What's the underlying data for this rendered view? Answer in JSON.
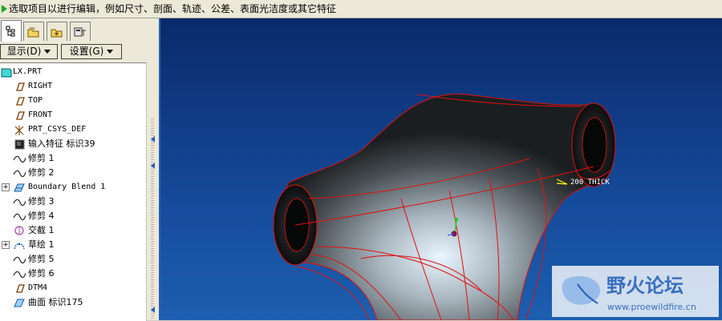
{
  "status": {
    "message": "选取项目以进行编辑，例如尺寸、剖面、轨迹、公差、表面光洁度或其它特征"
  },
  "tabs": [
    {
      "name": "model-tree"
    },
    {
      "name": "folder-browser"
    },
    {
      "name": "favorites"
    },
    {
      "name": "connections"
    }
  ],
  "toolbar": {
    "show_label": "显示(D)",
    "settings_label": "设置(G)"
  },
  "tree": {
    "items": [
      {
        "label": "LX.PRT",
        "icon": "part-icon"
      },
      {
        "label": "RIGHT",
        "icon": "datum-plane-icon"
      },
      {
        "label": "TOP",
        "icon": "datum-plane-icon"
      },
      {
        "label": "FRONT",
        "icon": "datum-plane-icon"
      },
      {
        "label": "PRT_CSYS_DEF",
        "icon": "coordinate-system-icon"
      },
      {
        "label": "输入特征 标识39",
        "icon": "import-feature-icon"
      },
      {
        "label": "修剪 1",
        "icon": "trim-curve-icon"
      },
      {
        "label": "修剪 2",
        "icon": "trim-curve-icon"
      },
      {
        "label": "Boundary Blend 1",
        "icon": "boundary-blend-icon"
      },
      {
        "label": "修剪 3",
        "icon": "trim-curve-icon"
      },
      {
        "label": "修剪 4",
        "icon": "trim-curve-icon"
      },
      {
        "label": "交截 1",
        "icon": "intersect-icon"
      },
      {
        "label": "草绘 1",
        "icon": "sketch-icon"
      },
      {
        "label": "修剪 5",
        "icon": "trim-curve-icon"
      },
      {
        "label": "修剪 6",
        "icon": "trim-curve-icon"
      },
      {
        "label": "DTM4",
        "icon": "datum-plane-icon"
      },
      {
        "label": "曲面 标识175",
        "icon": "surface-icon"
      }
    ]
  },
  "viewport": {
    "annotation": "200 THICK",
    "watermark_cn": "野火论坛",
    "watermark_url": "www.proewildfire.cn"
  },
  "colors": {
    "background_top": "#0a2a6a",
    "background_bottom": "#1d5fb0",
    "edge_red": "#e01010",
    "annotation_yellow": "#ffff00"
  }
}
